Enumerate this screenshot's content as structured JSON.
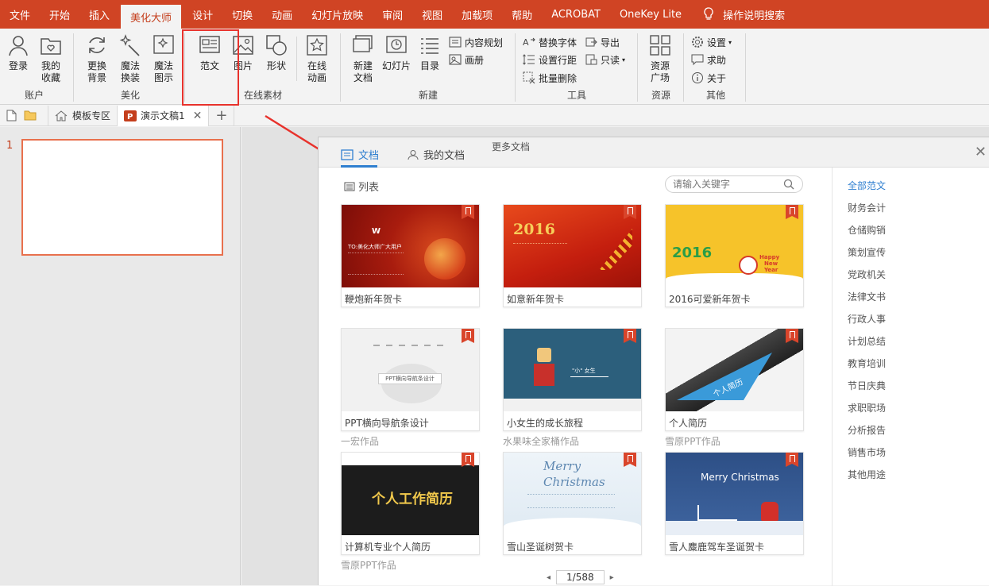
{
  "menubar": {
    "tabs": [
      "文件",
      "开始",
      "插入",
      "美化大师",
      "设计",
      "切换",
      "动画",
      "幻灯片放映",
      "审阅",
      "视图",
      "加载项",
      "帮助",
      "ACROBAT",
      "OneKey Lite"
    ],
    "active_tab": "美化大师",
    "help_search": "操作说明搜索"
  },
  "ribbon": {
    "account": {
      "label": "账户",
      "login": "登录",
      "fav_l1": "我的",
      "fav_l2": "收藏"
    },
    "beautify": {
      "label": "美化",
      "bg_l1": "更换",
      "bg_l2": "背景",
      "magic_l1": "魔法",
      "magic_l2": "换装",
      "chart_l1": "魔法",
      "chart_l2": "图示"
    },
    "online": {
      "label": "在线素材",
      "template": "范文",
      "picture": "图片",
      "shape": "形状",
      "anim_l1": "在线",
      "anim_l2": "动画"
    },
    "create": {
      "label": "新建",
      "newdoc_l1": "新建",
      "newdoc_l2": "文档",
      "slide": "幻灯片",
      "toc": "目录",
      "content_plan": "内容规划",
      "album": "画册"
    },
    "tools": {
      "label": "工具",
      "replace_font": "替换字体",
      "export": "导出",
      "line_spacing": "设置行距",
      "readonly": "只读",
      "batch_delete": "批量删除"
    },
    "resource": {
      "label": "资源",
      "plaza_l1": "资源",
      "plaza_l2": "广场"
    },
    "other": {
      "label": "其他",
      "settings": "设置",
      "help": "求助",
      "about": "关于"
    }
  },
  "tabstrip": {
    "template_zone": "模板专区",
    "doc_tab": "演示文稿1"
  },
  "slides": {
    "current": "1"
  },
  "panel": {
    "tab_docs": "文档",
    "tab_mydocs": "我的文档",
    "more_docs": "更多文档",
    "list_label": "列表",
    "search_placeholder": "请输入关键字",
    "page": "1/588",
    "cards": [
      {
        "title": "鞭炮新年贺卡",
        "author": ""
      },
      {
        "title": "如意新年贺卡",
        "author": ""
      },
      {
        "title": "2016可爱新年贺卡",
        "author": ""
      },
      {
        "title": "PPT横向导航条设计",
        "author": "一宏作品"
      },
      {
        "title": "小女生的成长旅程",
        "author": "水果味全家桶作品"
      },
      {
        "title": "个人简历",
        "author": "雪原PPT作品"
      },
      {
        "title": "计算机专业个人简历",
        "author": "雪原PPT作品"
      },
      {
        "title": "雪山圣诞树贺卡",
        "author": ""
      },
      {
        "title": "雪人麋鹿驾车圣诞贺卡",
        "author": ""
      }
    ],
    "thumb_text": {
      "c1_to": "TO:美化大师广大用户",
      "c2_year": "2016",
      "c3_year": "2016",
      "c3_happy": "Happy",
      "c3_new": "New",
      "c3_year_word": "Year",
      "c4_nav": "PPT横向导航条设计",
      "c5_name": "\"小\" 女生",
      "c6_resume": "个人简历",
      "c7_title": "个人工作简历",
      "c8_l1": "Merry",
      "c8_l2": "Christmas",
      "c9_title": "Merry Christmas"
    },
    "categories": [
      "全部范文",
      "财务会计",
      "仓储购销",
      "策划宣传",
      "党政机关",
      "法律文书",
      "行政人事",
      "计划总结",
      "教育培训",
      "节日庆典",
      "求职职场",
      "分析报告",
      "销售市场",
      "其他用途"
    ],
    "active_category": "全部范文"
  },
  "colors": {
    "brand": "#d04424",
    "highlight_box": "#e8322c",
    "accent_blue": "#2f7fd0"
  }
}
